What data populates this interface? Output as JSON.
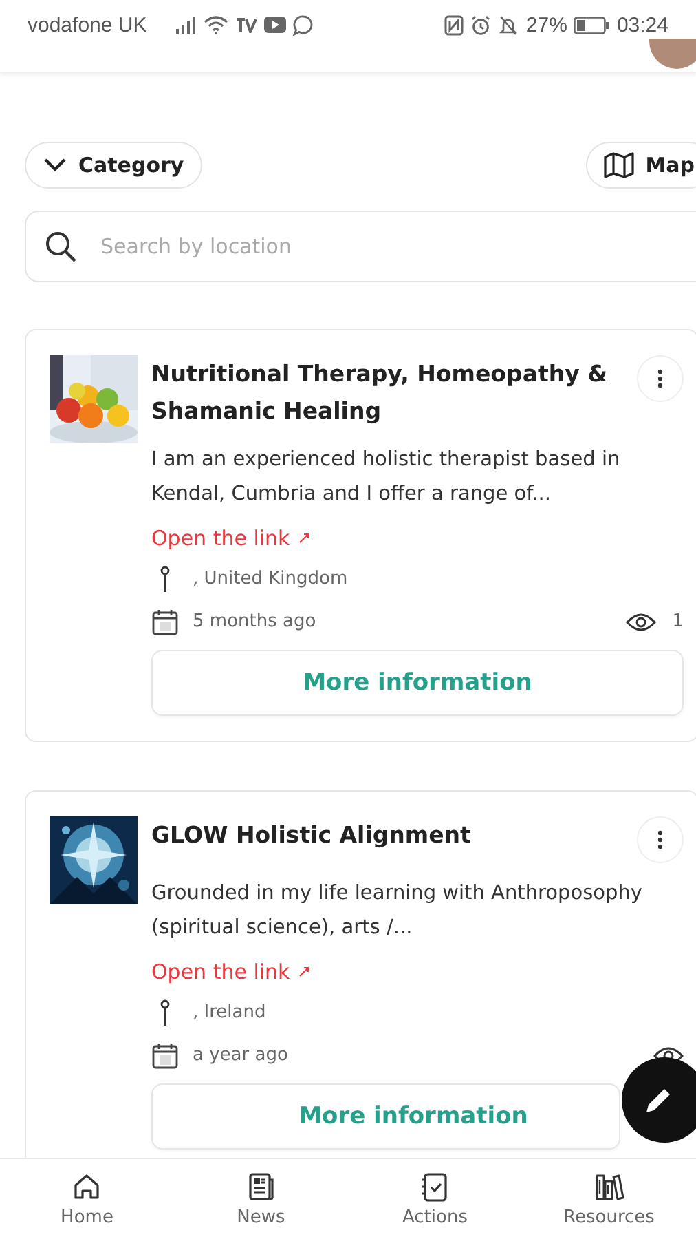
{
  "status_bar": {
    "carrier": "vodafone UK",
    "battery": "27%",
    "time": "03:24"
  },
  "filters": {
    "category": "Category",
    "map": "Map"
  },
  "search": {
    "placeholder": "Search by location"
  },
  "listings": [
    {
      "title": "Nutritional Therapy, Homeopathy & Shamanic Healing",
      "description": "I am an experienced holistic therapist based in Kendal, Cumbria and I offer a range of...",
      "link": "Open the link",
      "location": ", United Kingdom",
      "date": "5 months ago",
      "views": "1",
      "button": "More information"
    },
    {
      "title": "GLOW Holistic Alignment",
      "description": "Grounded in my life learning with Anthroposophy (spiritual science), arts /...",
      "link": "Open the link",
      "location": ", Ireland",
      "date": "a year ago",
      "button": "More information"
    }
  ],
  "nav": [
    {
      "label": "Home"
    },
    {
      "label": "News"
    },
    {
      "label": "Actions"
    },
    {
      "label": "Resources"
    }
  ]
}
